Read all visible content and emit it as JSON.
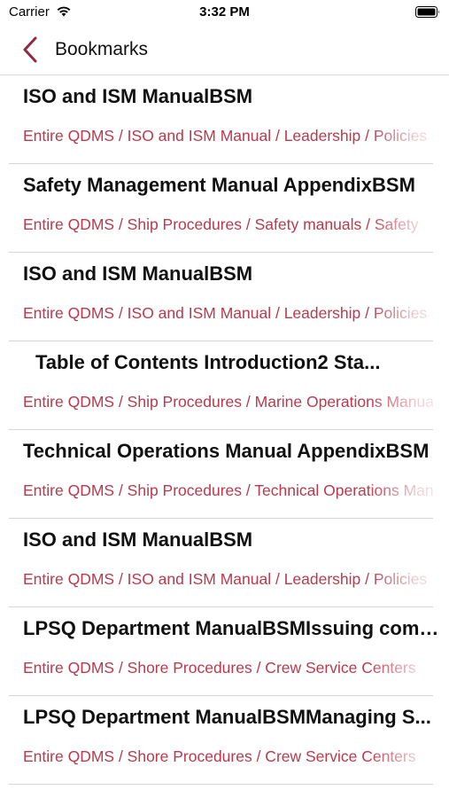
{
  "status_bar": {
    "carrier": "Carrier",
    "time": "3:32 PM"
  },
  "nav": {
    "title": "Bookmarks",
    "accent_color": "#8e2a44"
  },
  "path_color": "#b93a4d",
  "items": [
    {
      "title": "ISO and ISM ManualBSM",
      "path": "Entire QDMS / ISO and ISM Manual / Leadership / Policies"
    },
    {
      "title": "Safety Management Manual AppendixBSM",
      "path": "Entire QDMS / Ship Procedures / Safety manuals / Safety"
    },
    {
      "title": "ISO and ISM ManualBSM",
      "path": "Entire QDMS / ISO and ISM Manual / Leadership / Policies"
    },
    {
      "title": "Table of Contents   Introduction2 Sta...",
      "path": "Entire QDMS / Ship Procedures / Marine Operations Manual"
    },
    {
      "title": "Technical Operations Manual AppendixBSM",
      "path": "Entire QDMS / Ship Procedures / Technical Operations Manual"
    },
    {
      "title": "ISO and ISM ManualBSM",
      "path": "Entire QDMS / ISO and ISM Manual / Leadership / Policies"
    },
    {
      "title": "LPSQ Department ManualBSMIssuing comp...",
      "path": "Entire QDMS / Shore Procedures / Crew Service Centers"
    },
    {
      "title": "LPSQ Department ManualBSMManaging S...",
      "path": "Entire QDMS / Shore Procedures / Crew Service Centers"
    }
  ]
}
